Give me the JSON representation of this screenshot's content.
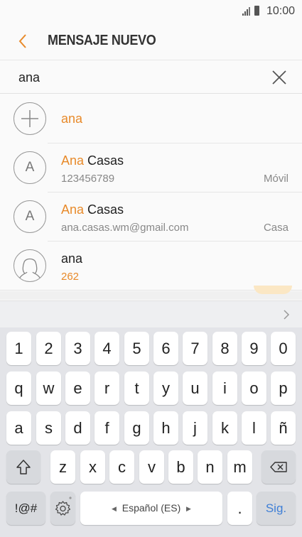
{
  "status": {
    "time": "10:00"
  },
  "header": {
    "title": "MENSAJE NUEVO"
  },
  "search": {
    "value": "ana"
  },
  "suggestions": [
    {
      "name_highlight": "ana",
      "name_rest": ""
    },
    {
      "name_highlight": "Ana",
      "name_rest": " Casas",
      "initial": "A",
      "detail": "123456789",
      "type": "Móvil"
    },
    {
      "name_highlight": "Ana",
      "name_rest": " Casas",
      "initial": "A",
      "detail": "ana.casas.wm@gmail.com",
      "type": "Casa"
    },
    {
      "name": "ana",
      "detail": "262"
    }
  ],
  "keyboard": {
    "row1": [
      "1",
      "2",
      "3",
      "4",
      "5",
      "6",
      "7",
      "8",
      "9",
      "0"
    ],
    "row2": [
      "q",
      "w",
      "e",
      "r",
      "t",
      "y",
      "u",
      "i",
      "o",
      "p"
    ],
    "row3": [
      "a",
      "s",
      "d",
      "f",
      "g",
      "h",
      "j",
      "k",
      "l",
      "ñ"
    ],
    "row4": [
      "z",
      "x",
      "c",
      "v",
      "b",
      "n",
      "m"
    ],
    "symbols_label": "!@#",
    "space_label": "Español (ES)",
    "period_label": ".",
    "next_label": "Sig."
  },
  "colors": {
    "accent": "#e88a2a",
    "next": "#3f7fd6"
  }
}
